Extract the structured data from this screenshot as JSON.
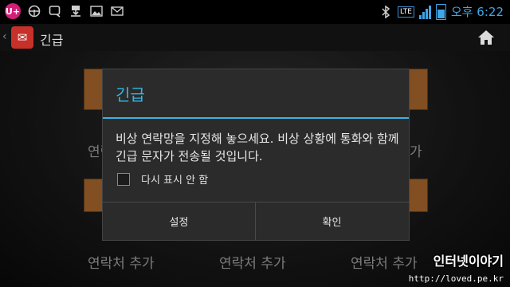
{
  "status_bar": {
    "carrier_badge": "U+",
    "network": "LTE",
    "time": "오후 6:22",
    "battery_level": 0.6,
    "signal_bars": 4,
    "left_icons": [
      "uplus-icon",
      "steering-wheel-icon",
      "search-chat-icon",
      "download-icon",
      "image-icon",
      "mail-icon"
    ],
    "right_icons": [
      "bluetooth-icon",
      "lte-icon",
      "signal-icon",
      "battery-icon"
    ]
  },
  "action_bar": {
    "title": "긴급",
    "app_icon": "emergency-contact-icon",
    "home_icon": "home-icon"
  },
  "background": {
    "labels": [
      "연락처 추가",
      "연락처 추가",
      "연락처 추가"
    ],
    "partial_labels": [
      "연락",
      "가"
    ]
  },
  "dialog": {
    "title": "긴급",
    "message": "비상 연락망을 지정해 놓으세요. 비상 상황에 통화와 함께 긴급 문자가 전송될 것입니다.",
    "checkbox_label": "다시 표시 안 함",
    "checkbox_checked": false,
    "buttons": {
      "settings": "설정",
      "confirm": "확인"
    }
  },
  "watermark": {
    "brand": "인터넷이야기",
    "url": "http://loved.pe.kr"
  },
  "colors": {
    "accent": "#33b5e5",
    "card": "#c77a33"
  }
}
